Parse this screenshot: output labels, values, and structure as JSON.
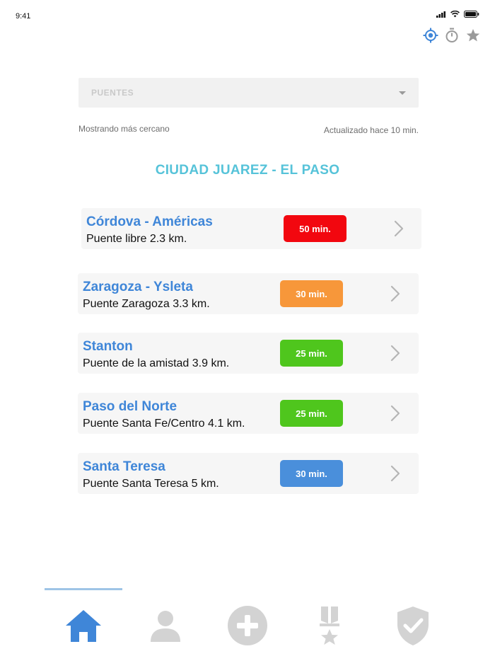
{
  "status": {
    "time": "9:41"
  },
  "filter": {
    "selected": "PUENTES"
  },
  "info": {
    "left": "Mostrando más cercano",
    "right": "Actualizado hace 10 min."
  },
  "region": {
    "title": "CIUDAD JUAREZ - EL PASO"
  },
  "crossings": [
    {
      "name": "Córdova - Américas",
      "detail": "Puente libre 2.3 km.",
      "wait": "50 min.",
      "color": "#f2070f"
    },
    {
      "name": "Zaragoza - Ysleta",
      "detail": "Puente Zaragoza  3.3 km.",
      "wait": "30 min.",
      "color": "#f7973a"
    },
    {
      "name": "Stanton",
      "detail": "Puente de la amistad 3.9 km.",
      "wait": "25 min.",
      "color": "#4fc61d"
    },
    {
      "name": "Paso del Norte",
      "detail": "Puente Santa Fe/Centro 4.1 km.",
      "wait": "25 min.",
      "color": "#4fc61d"
    },
    {
      "name": "Santa Teresa",
      "detail": "Puente Santa Teresa  5 km.",
      "wait": "30 min.",
      "color": "#4a8fdb"
    }
  ],
  "top_actions": [
    "location-icon",
    "stopwatch-icon",
    "star-icon"
  ],
  "tabs": [
    "home-icon",
    "user-icon",
    "add-icon",
    "medal-icon",
    "shield-check-icon"
  ],
  "colors": {
    "accent": "#3f86d8",
    "title": "#56c3d9",
    "tab_inactive": "#d3d3d3"
  }
}
